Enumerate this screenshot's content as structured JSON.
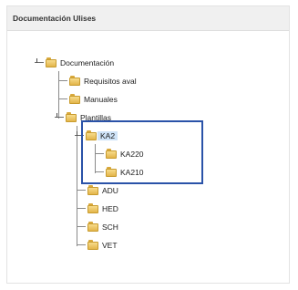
{
  "panel": {
    "title": "Documentación Ulises"
  },
  "tree": {
    "root": "Documentación",
    "requisitos": "Requisitos aval",
    "manuales": "Manuales",
    "plantillas": "Plantillas",
    "ka2": "KA2",
    "ka220": "KA220",
    "ka210": "KA210",
    "adu": "ADU",
    "hed": "HED",
    "sch": "SCH",
    "vet": "VET"
  },
  "colors": {
    "highlight": "#2a52a8",
    "selection": "#cfe3f7",
    "folder": "#e3b54a"
  }
}
